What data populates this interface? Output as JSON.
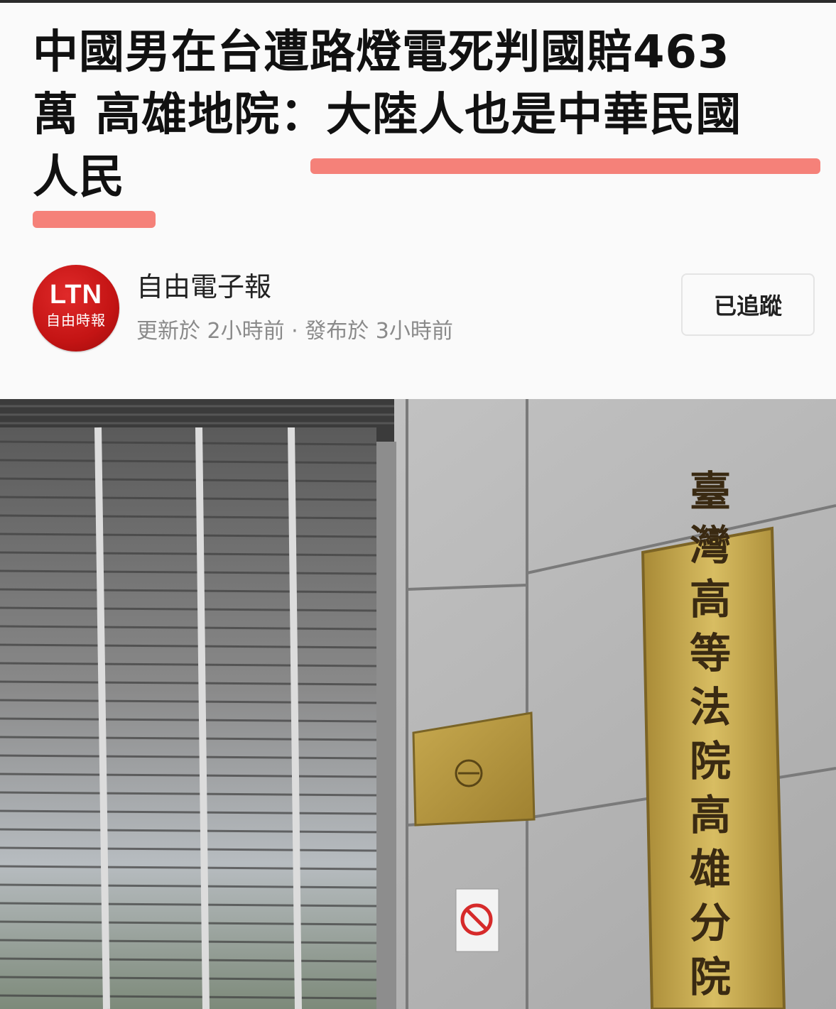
{
  "article": {
    "headline_line1": "中國男在台遭路燈電死判國賠463",
    "headline_line2": "萬 高雄地院：大陸人也是中華民國",
    "headline_line3": "人民"
  },
  "source": {
    "logo_text": "LTN",
    "logo_subtext": "自由時報",
    "name": "自由電子報",
    "meta": "更新於 2小時前 · 發布於 3小時前",
    "follow_label": "已追蹤"
  },
  "photo": {
    "plaque_text": "臺灣高等法院高雄分院"
  },
  "colors": {
    "highlight": "#f47a72",
    "logo_red": "#c41414",
    "plaque_gold": "#c9a94a"
  }
}
